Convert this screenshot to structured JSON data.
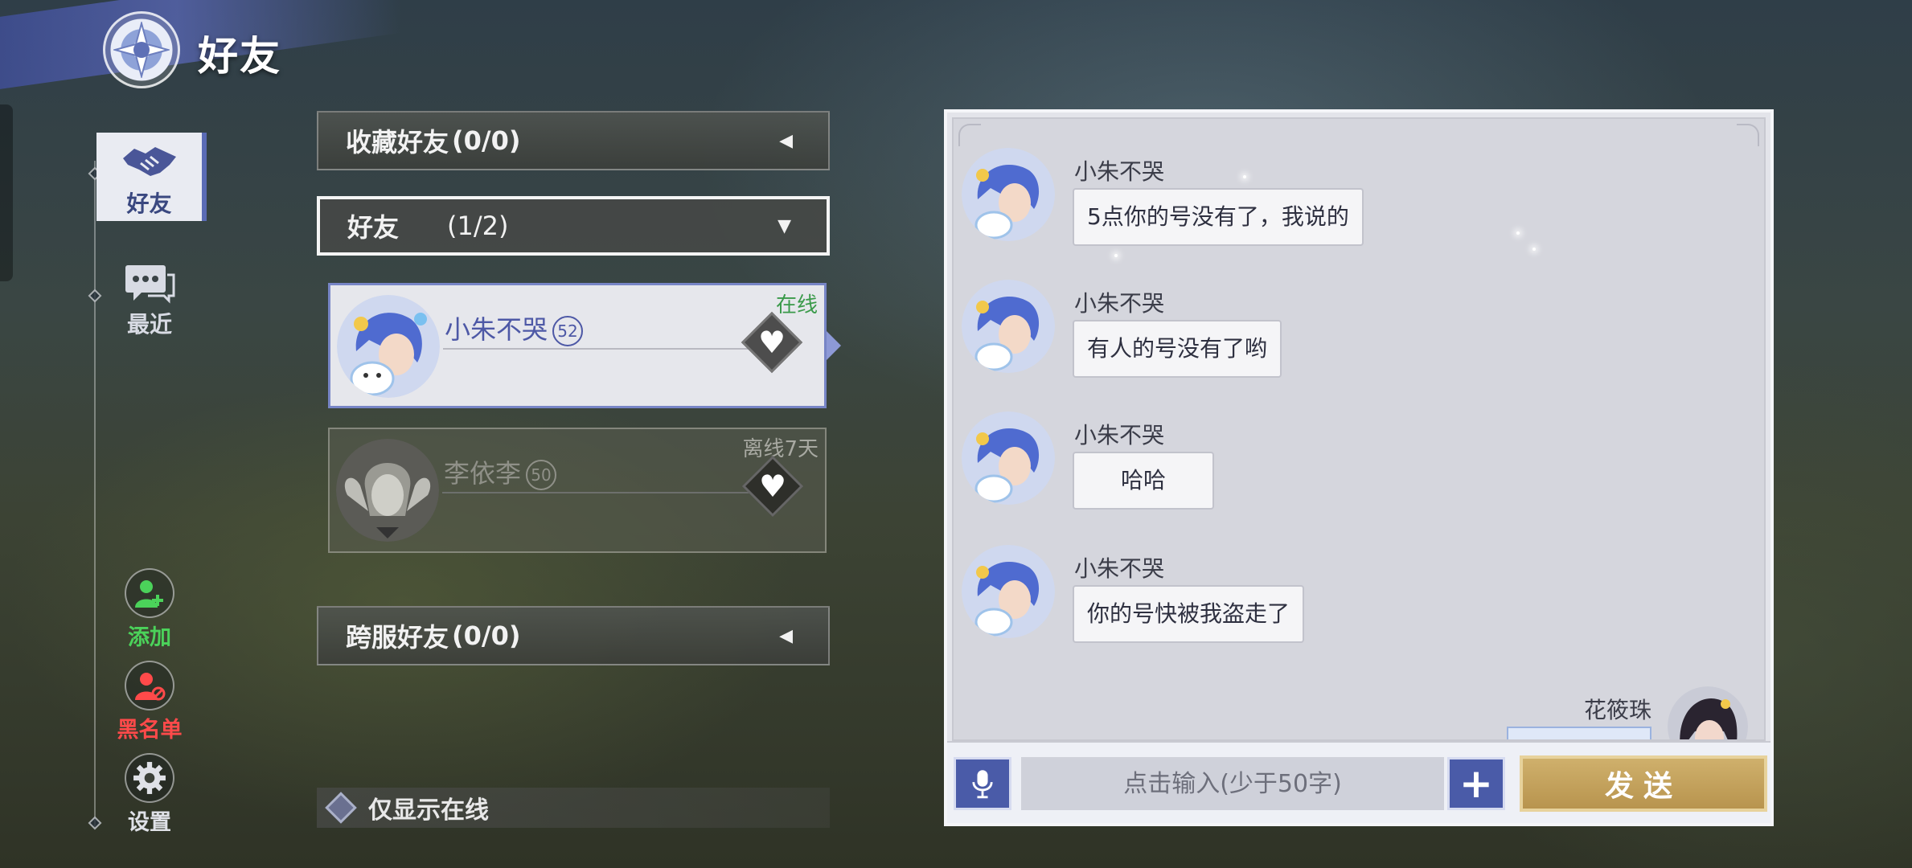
{
  "header": {
    "title": "好友"
  },
  "nav": {
    "friends": "好友",
    "recent": "最近",
    "add": "添加",
    "blacklist": "黑名单",
    "settings": "设置"
  },
  "groups": {
    "favorites": {
      "label": "收藏好友",
      "count": "(0/0)"
    },
    "friends": {
      "label": "好友",
      "count": "(1/2)"
    },
    "cross_server": {
      "label": "跨服好友",
      "count": "(0/0)"
    }
  },
  "friends": [
    {
      "name": "小朱不哭",
      "level": "52",
      "status": "在线"
    },
    {
      "name": "李依李",
      "level": "50",
      "status": "离线7天"
    }
  ],
  "filter": {
    "online_only": "仅显示在线"
  },
  "chat": {
    "messages": [
      {
        "sender": "小朱不哭",
        "text": "5点你的号没有了，我说的"
      },
      {
        "sender": "小朱不哭",
        "text": "有人的号没有了哟"
      },
      {
        "sender": "小朱不哭",
        "text": "哈哈"
      },
      {
        "sender": "小朱不哭",
        "text": "你的号快被我盗走了"
      }
    ],
    "self_name": "花筱珠",
    "input_placeholder": "点击输入(少于50字)",
    "send": "发送"
  },
  "colors": {
    "accent": "#4a5ba8",
    "online": "#3a9a4a",
    "blacklist": "#ff4a4a",
    "add": "#4bd25a",
    "send": "#c4a25c"
  }
}
